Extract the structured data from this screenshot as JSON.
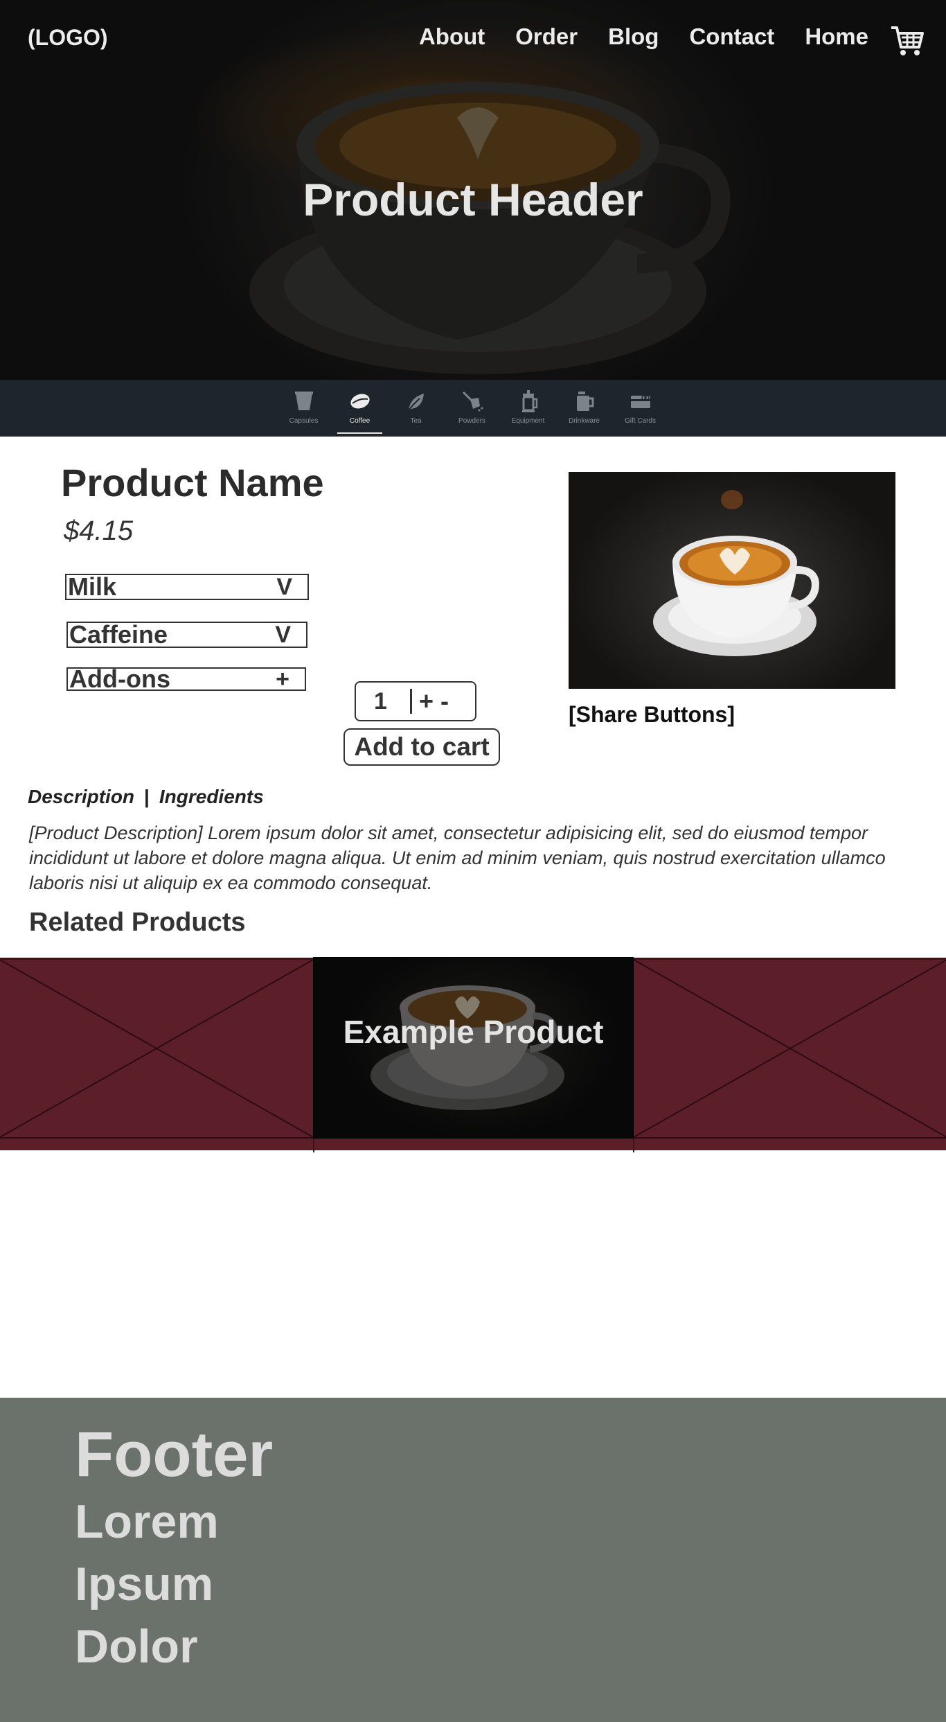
{
  "header": {
    "logo": "(LOGO)",
    "nav": [
      "About",
      "Order",
      "Blog",
      "Contact",
      "Home"
    ],
    "cart_icon": "cart-icon",
    "hero_title": "Product Header"
  },
  "categories": {
    "items": [
      {
        "label": "Capsules",
        "icon": "capsule-icon"
      },
      {
        "label": "Coffee",
        "icon": "coffee-bean-icon"
      },
      {
        "label": "Tea",
        "icon": "tea-leaf-icon"
      },
      {
        "label": "Powders",
        "icon": "powder-scoop-icon"
      },
      {
        "label": "Equipment",
        "icon": "french-press-icon"
      },
      {
        "label": "Drinkware",
        "icon": "mug-icon"
      },
      {
        "label": "Gift Cards",
        "icon": "gift-card-icon"
      }
    ],
    "active": "Coffee"
  },
  "product": {
    "name": "Product Name",
    "price": "$4.15",
    "options": [
      {
        "label": "Milk",
        "indicator": "V"
      },
      {
        "label": "Caffeine",
        "indicator": "V"
      },
      {
        "label": "Add-ons",
        "indicator": "+"
      }
    ],
    "quantity": "1",
    "qty_plus": "+",
    "qty_minus": "-",
    "add_to_cart": "Add to cart",
    "share": "[Share Buttons]"
  },
  "details": {
    "tabs": [
      "Description",
      "Ingredients"
    ],
    "separator": "|",
    "description": "[Product Description] Lorem ipsum dolor sit amet, consectetur adipisicing elit, sed do eiusmod tempor incididunt ut labore et dolore magna aliqua. Ut enim ad minim veniam, quis nostrud exercitation ullamco laboris nisi ut aliquip ex ea commodo consequat."
  },
  "related": {
    "heading": "Related Products",
    "featured_title": "Example Product"
  },
  "footer": {
    "title": "Footer",
    "items": [
      "Lorem",
      "Ipsum",
      "Dolor"
    ]
  },
  "colors": {
    "category_bar": "#1e252d",
    "carousel_bg": "#5c1f2a",
    "footer_bg": "#6b716b"
  }
}
